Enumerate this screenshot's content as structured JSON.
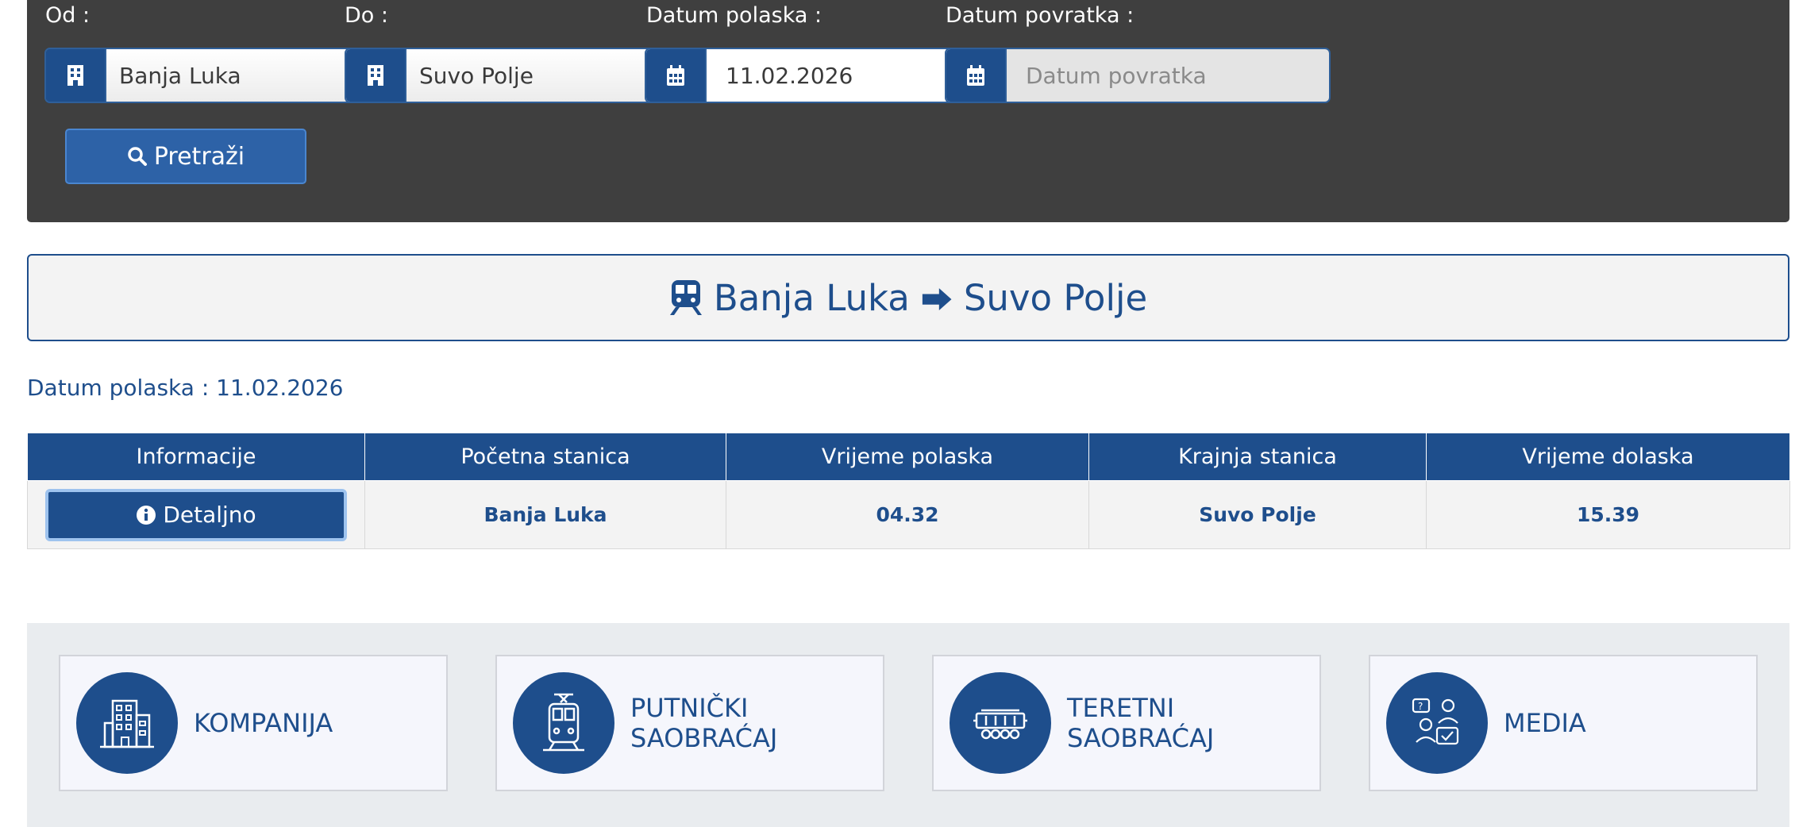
{
  "search": {
    "from": {
      "label": "Od :",
      "value": "Banja Luka"
    },
    "to": {
      "label": "Do :",
      "value": "Suvo Polje"
    },
    "departure": {
      "label": "Datum polaska :",
      "value": "11.02.2026"
    },
    "return": {
      "label": "Datum povratka :",
      "placeholder": "Datum povratka"
    },
    "button_label": "Pretraži"
  },
  "route": {
    "origin": "Banja Luka",
    "arrow": "⮕",
    "destination": "Suvo Polje"
  },
  "departure_date_line": "Datum polaska : 11.02.2026",
  "table": {
    "headers": [
      "Informacije",
      "Početna stanica",
      "Vrijeme polaska",
      "Krajnja stanica",
      "Vrijeme dolaska"
    ],
    "rows": [
      {
        "button_label": "Detaljno",
        "start_station": "Banja Luka",
        "departure_time": "04.32",
        "end_station": "Suvo Polje",
        "arrival_time": "15.39"
      }
    ]
  },
  "cards": [
    {
      "label": "KOMPANIJA",
      "icon": "building-icon"
    },
    {
      "label": "PUTNIČKI\nSAOBRAĆAJ",
      "icon": "passenger-train-icon"
    },
    {
      "label": "TERETNI\nSAOBRAĆAJ",
      "icon": "freight-wagon-icon"
    },
    {
      "label": "MEDIA",
      "icon": "media-people-icon"
    }
  ],
  "colors": {
    "primary": "#1e4e8c",
    "panel": "#3f3f3f",
    "cards_bg": "#e9ecef"
  }
}
